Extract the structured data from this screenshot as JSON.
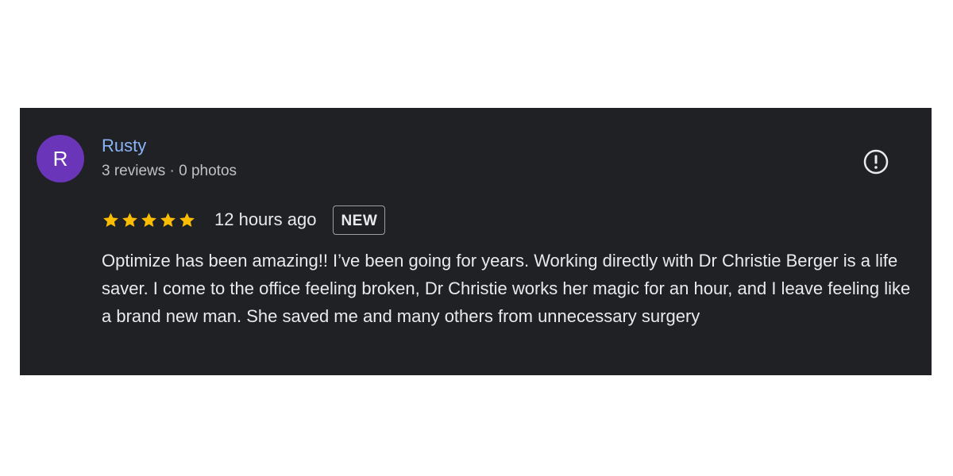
{
  "review": {
    "avatar_letter": "R",
    "reviewer_name": "Rusty",
    "reviewer_meta": "3 reviews · 0 photos",
    "rating": 5,
    "rating_max": 5,
    "time_ago": "12 hours ago",
    "badge": "NEW",
    "text": "Optimize has been amazing!! I’ve been going for years. Working directly with Dr Christie Berger is a life saver. I come to the office feeling broken, Dr Christie works her magic for an hour, and I leave feeling like a brand new man. She saved me and many others from unnecessary surgery",
    "report_icon": "report-flag-icon"
  },
  "colors": {
    "card_background": "#202124",
    "avatar_background": "#6a35b8",
    "name_color": "#8ab4f8",
    "star_color": "#fbbc04"
  }
}
